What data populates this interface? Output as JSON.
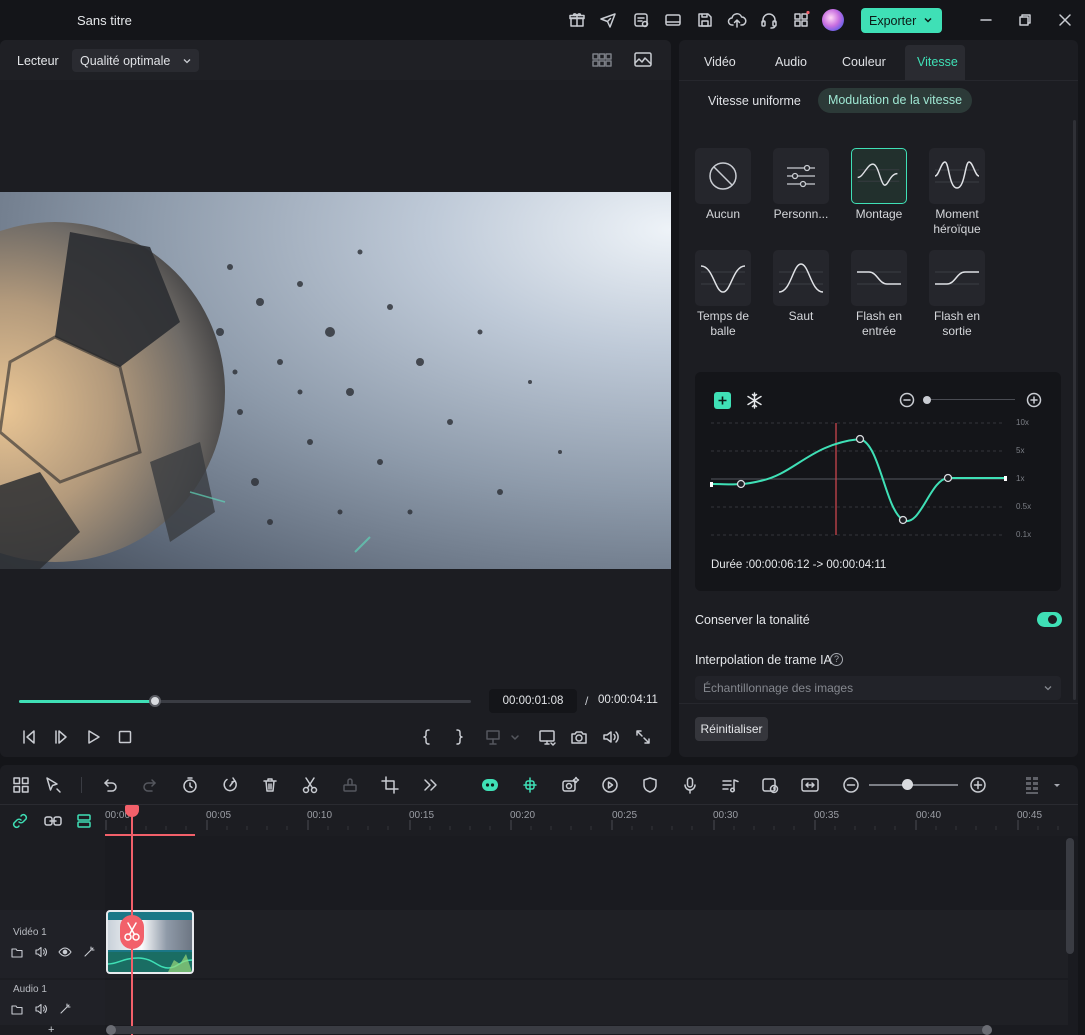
{
  "window": {
    "title": "Sans titre",
    "export_label": "Exporter"
  },
  "player": {
    "label": "Lecteur",
    "quality": "Qualité optimale",
    "progress": 0.3,
    "time_current": "00:00:01:08",
    "time_separator": "/",
    "time_total": "00:00:04:11"
  },
  "tabs": [
    {
      "label": "Vidéo"
    },
    {
      "label": "Audio"
    },
    {
      "label": "Couleur"
    },
    {
      "label": "Vitesse",
      "active": true
    }
  ],
  "speed": {
    "subtabs": {
      "uniform": "Vitesse uniforme",
      "modulation": "Modulation de la vitesse"
    },
    "presets": [
      {
        "label": "Aucun",
        "icon": "none-icon"
      },
      {
        "label": "Personn...",
        "icon": "custom-sliders-icon"
      },
      {
        "label": "Montage",
        "icon": "montage-curve-icon",
        "selected": true
      },
      {
        "label": "Moment héroïque",
        "icon": "hero-moment-curve-icon"
      },
      {
        "label": "Temps de balle",
        "icon": "bullet-time-curve-icon"
      },
      {
        "label": "Saut",
        "icon": "jump-curve-icon"
      },
      {
        "label": "Flash en entrée",
        "icon": "flash-in-curve-icon"
      },
      {
        "label": "Flash en sortie",
        "icon": "flash-out-curve-icon"
      }
    ],
    "curve": {
      "y_ticks": [
        "10x",
        "5x",
        "1x",
        "0.5x",
        "0.1x"
      ],
      "duration_text": "Durée :00:00:06:12 -> 00:00:04:11"
    },
    "keep_tone_label": "Conserver la tonalité",
    "keep_tone_on": true,
    "interp_label": "Interpolation de trame IA",
    "interp_help": "?",
    "interp_value": "Échantillonnage des images",
    "reset_label": "Réinitialiser"
  },
  "timeline": {
    "ticks": [
      "00:00",
      "00:05",
      "00:10",
      "00:15",
      "00:20",
      "00:25",
      "00:30",
      "00:35",
      "00:40",
      "00:45"
    ],
    "tracks": {
      "video": "Vidéo 1",
      "audio": "Audio 1"
    },
    "zoom": 0.43
  },
  "colors": {
    "accent": "#3fe0b6",
    "playhead": "#f2606a",
    "panel": "#1c1d22"
  }
}
